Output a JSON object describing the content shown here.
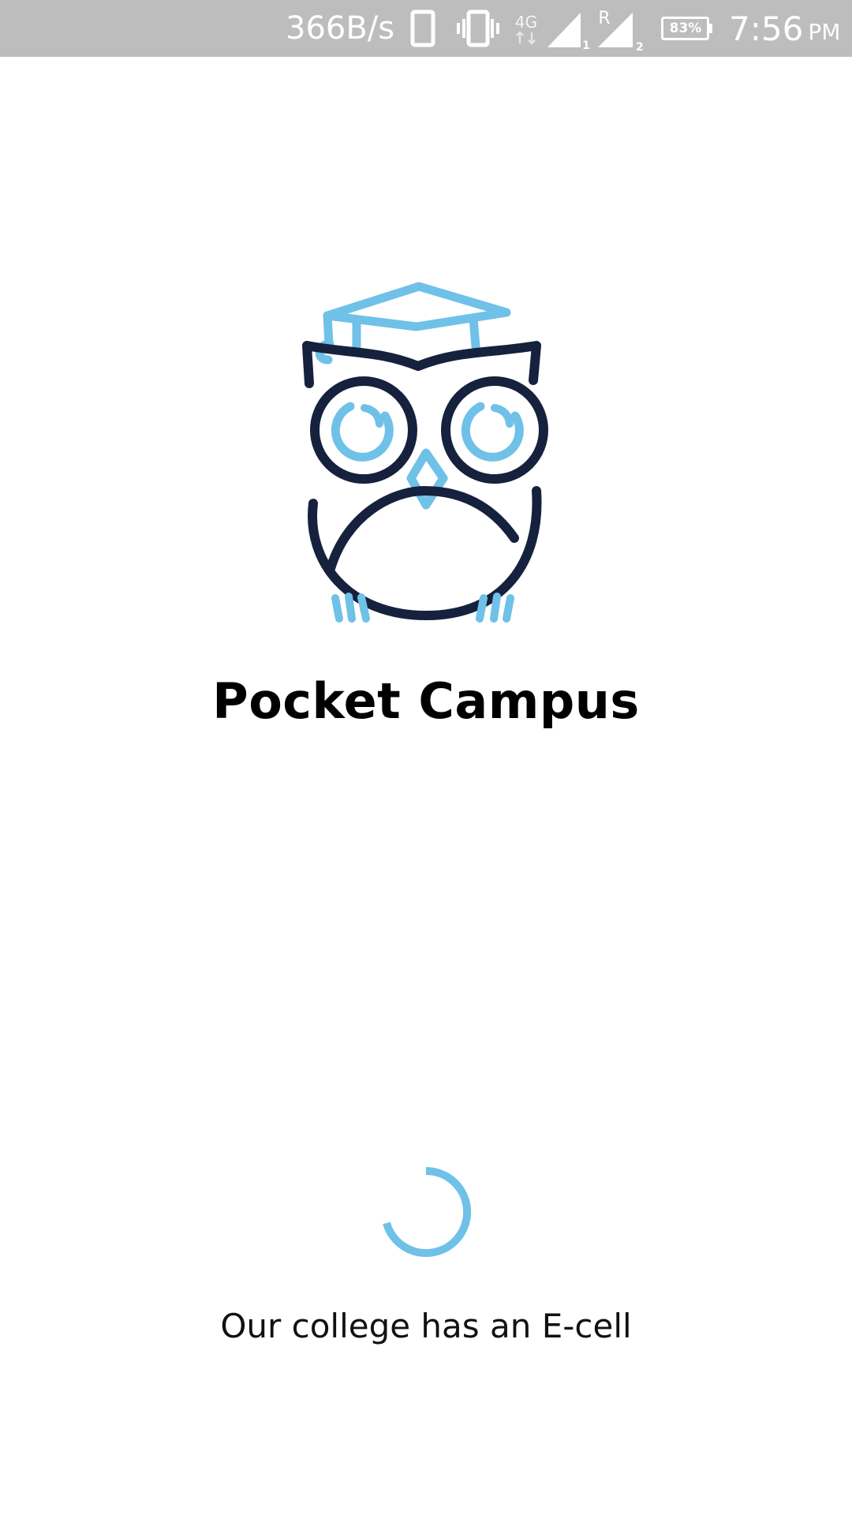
{
  "status_bar": {
    "net_speed": "366B/s",
    "battery_percent": "83%",
    "time": "7:56",
    "ampm": "PM",
    "network_type": "4G",
    "roaming_indicator": "R",
    "sim1_label": "1",
    "sim2_label": "2",
    "icons": [
      "phone-icon",
      "vibrate-icon",
      "4g-data-icon",
      "signal-sim1-icon",
      "signal-sim2-roaming-icon",
      "battery-icon"
    ],
    "background_color": "#bdbdbd"
  },
  "splash": {
    "app_title": "Pocket Campus",
    "tagline": "Our college has an E-cell",
    "logo_icon": "owl-graduation-cap-icon",
    "loading_icon": "loading-spinner-icon"
  },
  "colors": {
    "accent_blue": "#6fc1e8",
    "navy": "#16213e",
    "text": "#000000"
  }
}
